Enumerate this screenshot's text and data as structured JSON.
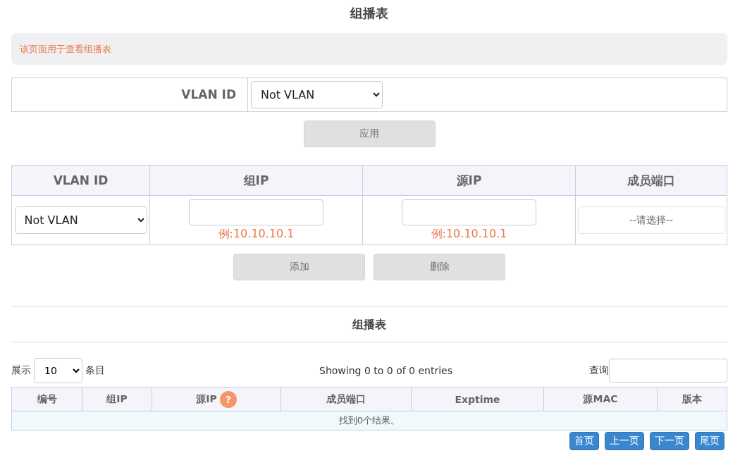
{
  "title": "组播表",
  "info": "该页面用于查看组播表",
  "form": {
    "label": "VLAN ID",
    "select_value": "Not VLAN"
  },
  "apply_button": {
    "label": "应用",
    "disabled": true
  },
  "add_table": {
    "columns": [
      "VLAN ID",
      "组IP",
      "源IP",
      "成员端口"
    ],
    "vlan_select": "Not VLAN",
    "group_ip_hint": "例:10.10.10.1",
    "source_ip_hint": "例:10.10.10.1",
    "port_select": "--请选择--"
  },
  "action_buttons": [
    {
      "label": "添加",
      "disabled": true
    },
    {
      "label": "删除",
      "disabled": true
    }
  ],
  "list_title": "组播表",
  "length_control": {
    "prefix": "展示",
    "value": "10",
    "suffix": "条目"
  },
  "info_text": "Showing 0 to 0 of 0 entries",
  "search": {
    "label": "查询"
  },
  "table": {
    "columns": [
      {
        "label": "编号"
      },
      {
        "label": "组IP"
      },
      {
        "label": "源IP",
        "help": "?"
      },
      {
        "label": "成员端口"
      },
      {
        "label": "Exptime"
      },
      {
        "label": "源MAC"
      },
      {
        "label": "版本"
      }
    ],
    "empty_text": "找到0个结果。"
  },
  "pagination": [
    "首页",
    "上一页",
    "下一页",
    "尾页"
  ]
}
